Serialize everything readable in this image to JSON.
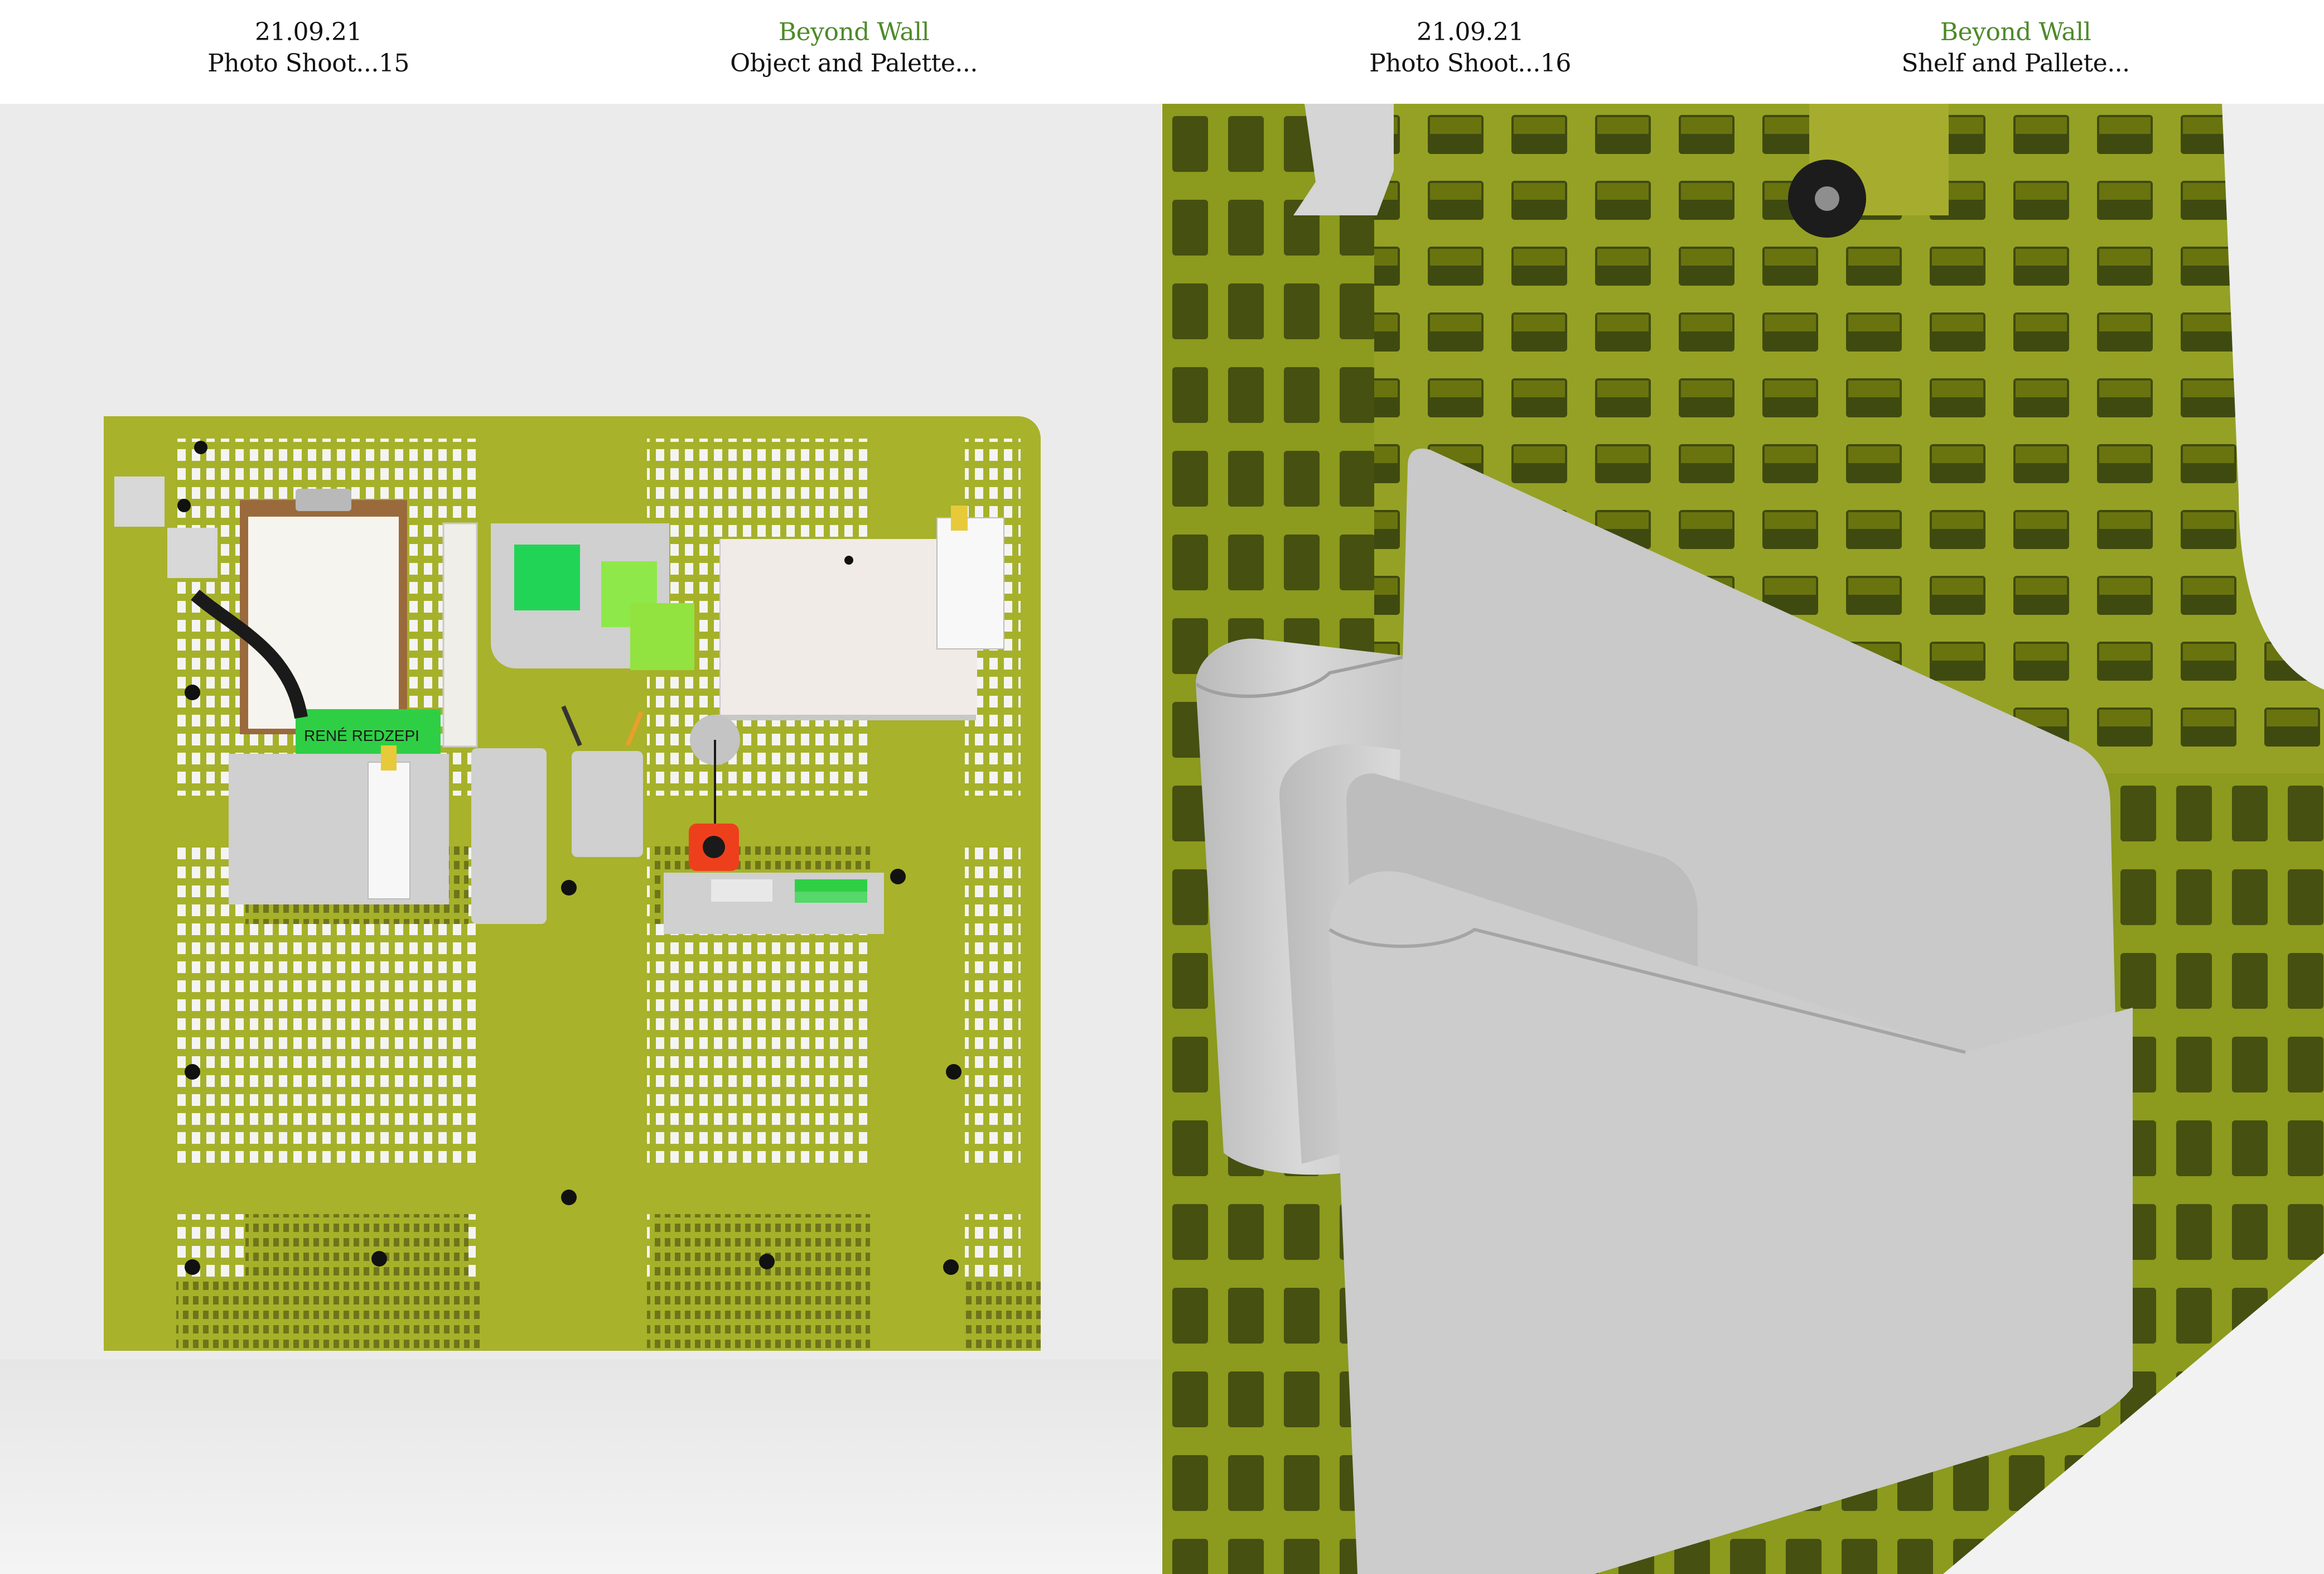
{
  "captions": [
    {
      "line1": "21.09.21",
      "line2": "Photo Shoot...15"
    },
    {
      "line1": "Beyond Wall",
      "line2": "Object and Palette..."
    },
    {
      "line1": "21.09.21",
      "line2": "Photo Shoot...16"
    },
    {
      "line1": "Beyond Wall",
      "line2": "Shelf and Pallete..."
    }
  ],
  "photo_left": {
    "label_text": "RENÉ REDZEPI"
  },
  "colors": {
    "series_green": "#4d8a2a",
    "pallet_green": "#a8b22a",
    "shelf_grey": "#cfd0cf",
    "backdrop": "#ecebec"
  }
}
